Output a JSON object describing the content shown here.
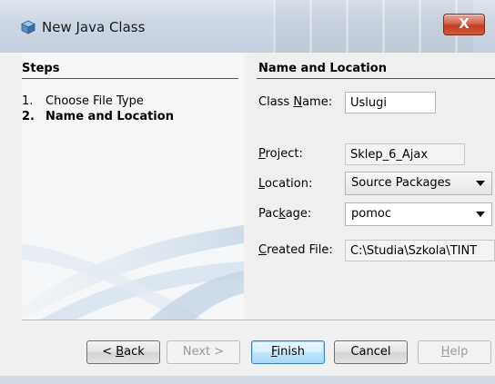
{
  "window": {
    "title": "New Java Class",
    "close_glyph": "X"
  },
  "steps": {
    "heading": "Steps",
    "items": [
      {
        "num": "1.",
        "label": "Choose File Type",
        "current": false
      },
      {
        "num": "2.",
        "label": "Name and Location",
        "current": true
      }
    ]
  },
  "form": {
    "heading": "Name and Location",
    "class_name": {
      "label_pre": "Class ",
      "label_key": "N",
      "label_post": "ame:",
      "value": "Uslugi"
    },
    "project": {
      "label_key": "P",
      "label_post": "roject:",
      "value": "Sklep_6_Ajax"
    },
    "location": {
      "label_key": "L",
      "label_post": "ocation:",
      "value": "Source Packages"
    },
    "package": {
      "label_pre": "Pac",
      "label_key": "k",
      "label_post": "age:",
      "value": "pomoc"
    },
    "created_file": {
      "label_key": "C",
      "label_post": "reated File:",
      "value": "C:\\Studia\\Szkola\\TINT"
    }
  },
  "buttons": {
    "back": {
      "pre": "< ",
      "key": "B",
      "post": "ack"
    },
    "next": "Next >",
    "finish": {
      "key": "F",
      "post": "inish"
    },
    "cancel": "Cancel",
    "help": {
      "key": "H",
      "post": "elp"
    }
  },
  "colors": {
    "titlebar": "#cdd7e4",
    "close": "#c23d22",
    "default_button": "#bee6fd"
  }
}
